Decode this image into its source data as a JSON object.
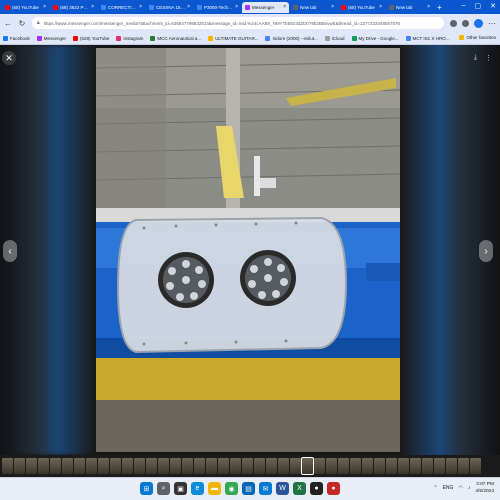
{
  "browser": {
    "tabs": [
      {
        "label": "(68) YouTube",
        "color": "#ff0000",
        "active": false
      },
      {
        "label": "(68) 3622 PINABELLO",
        "color": "#ff0000",
        "active": false
      },
      {
        "label": "CORRECTIONS - Gen",
        "color": "#4285f4",
        "active": false
      },
      {
        "label": "CESSNA 152 (PROMO)",
        "color": "#4285f4",
        "active": false
      },
      {
        "label": "P3000-Tech1_TECHN",
        "color": "#4285f4",
        "active": false
      },
      {
        "label": "Messenger",
        "color": "#a033ff",
        "active": true
      },
      {
        "label": "New tab",
        "color": "#5f6368",
        "active": false
      },
      {
        "label": "(68) YouTube",
        "color": "#ff0000",
        "active": false
      },
      {
        "label": "New tab",
        "color": "#5f6368",
        "active": false
      }
    ],
    "new_tab": "+",
    "window_controls": {
      "minimize": "–",
      "maximize": "▢",
      "close": "✕"
    },
    "url": "https://www.messenger.com/messenger_media?attachment_id=936847796832814&message_id=mid.%24cAAB9_NMYTbBGi3dZD079b2BBsvwE&thread_id=1277233448567576",
    "bookmarks": [
      {
        "label": "Facebook",
        "color": "#1877f2"
      },
      {
        "label": "Messenger",
        "color": "#a033ff"
      },
      {
        "label": "(628) YouTube",
        "color": "#ff0000"
      },
      {
        "label": "Instagram",
        "color": "#e1306c"
      },
      {
        "label": "MCC Aeronautical a...",
        "color": "#2e7d32"
      },
      {
        "label": "ULTIMATE GUITAR...",
        "color": "#f4b400"
      },
      {
        "label": "Indore (2000) - evilut...",
        "color": "#4285f4"
      },
      {
        "label": "iCloud",
        "color": "#9e9e9e"
      },
      {
        "label": "My Drive - Google...",
        "color": "#0f9d58"
      },
      {
        "label": "MCT IS1 X HRO...",
        "color": "#4285f4"
      }
    ],
    "other_favorites": "Other favorites"
  },
  "viewer": {
    "close": "✕",
    "prev": "‹",
    "next": "›",
    "tools": {
      "download": "⤓",
      "more": "⋮"
    },
    "thumbnail_count": 40,
    "current_thumbnail": 25
  },
  "taskbar": {
    "icons": [
      {
        "name": "start-icon",
        "glyph": "⊞",
        "color": "#0078d4"
      },
      {
        "name": "search-icon",
        "glyph": "⌕",
        "color": "#5f6368"
      },
      {
        "name": "task-view-icon",
        "glyph": "▣",
        "color": "#333"
      },
      {
        "name": "edge-icon",
        "glyph": "e",
        "color": "#0c8cd8"
      },
      {
        "name": "file-explorer-icon",
        "glyph": "▬",
        "color": "#f2b705"
      },
      {
        "name": "chrome-icon",
        "glyph": "◉",
        "color": "#34a853"
      },
      {
        "name": "store-icon",
        "glyph": "▤",
        "color": "#0067b8"
      },
      {
        "name": "mail-icon",
        "glyph": "✉",
        "color": "#0078d4"
      },
      {
        "name": "word-icon",
        "glyph": "W",
        "color": "#2b579a"
      },
      {
        "name": "excel-icon",
        "glyph": "X",
        "color": "#217346"
      },
      {
        "name": "app-icon",
        "glyph": "●",
        "color": "#222"
      },
      {
        "name": "app-icon-2",
        "glyph": "●",
        "color": "#c62828"
      }
    ],
    "tray": {
      "lang": "ENG",
      "time": "3:07 PM",
      "date": "4/5/2023"
    }
  }
}
